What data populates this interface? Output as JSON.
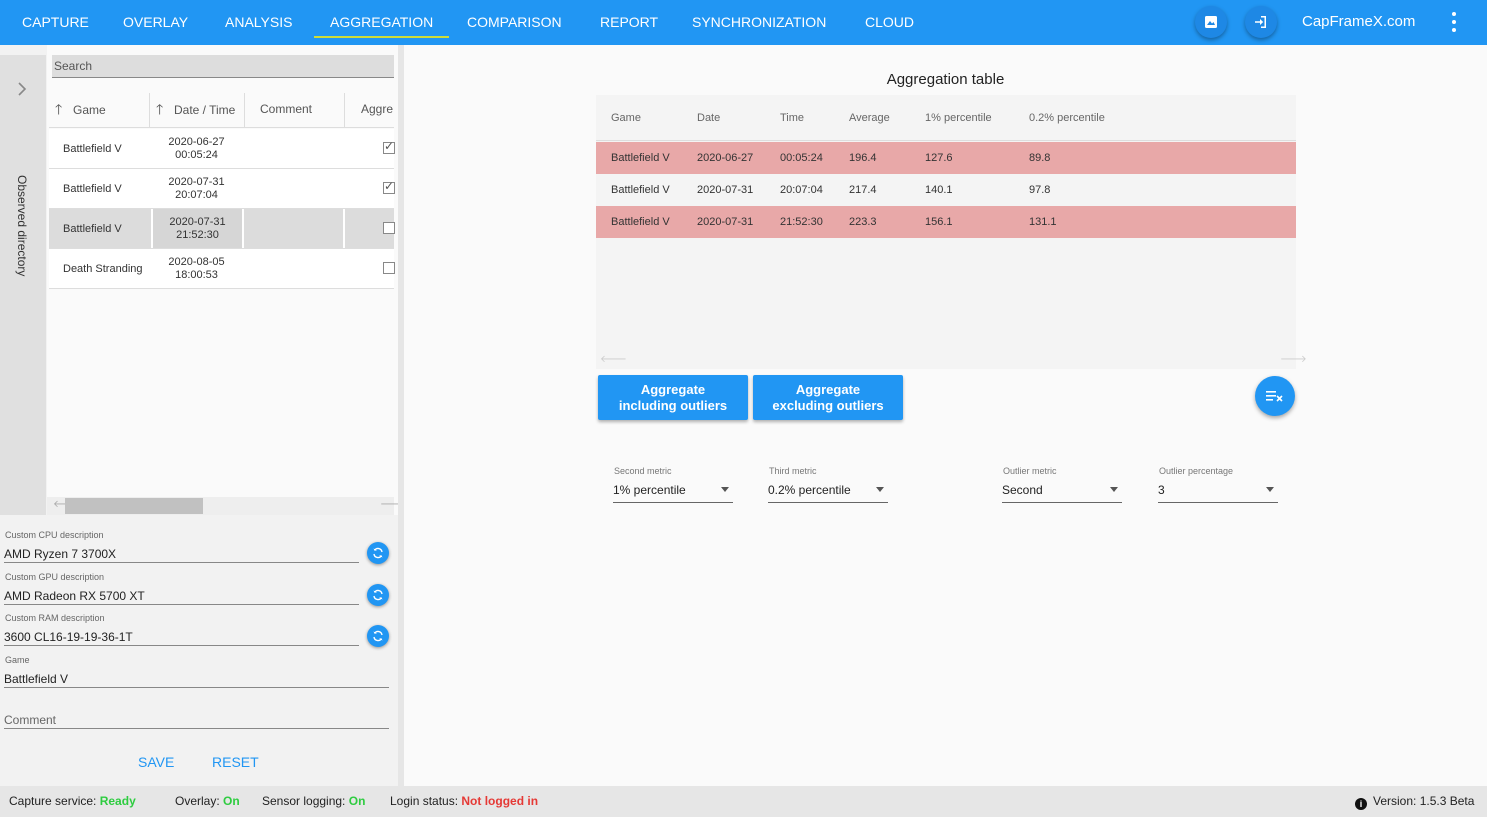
{
  "nav": {
    "tabs": [
      "CAPTURE",
      "OVERLAY",
      "ANALYSIS",
      "AGGREGATION",
      "COMPARISON",
      "REPORT",
      "SYNCHRONIZATION",
      "CLOUD"
    ],
    "active_tab": "AGGREGATION",
    "icons": [
      "screenshot-icon",
      "login-icon",
      "more-vert-icon"
    ],
    "brand": "CapFrameX.com"
  },
  "observed_directory": {
    "label": "Observed directory"
  },
  "records": {
    "search_placeholder": "Search",
    "columns": [
      "Game",
      "Date / Time",
      "Comment",
      "Aggre"
    ],
    "rows": [
      {
        "game": "Battlefield V",
        "date": "2020-06-27",
        "time": "00:05:24",
        "comment": "",
        "aggregate": true,
        "selected": false
      },
      {
        "game": "Battlefield V",
        "date": "2020-07-31",
        "time": "20:07:04",
        "comment": "",
        "aggregate": true,
        "selected": false
      },
      {
        "game": "Battlefield V",
        "date": "2020-07-31",
        "time": "21:52:30",
        "comment": "",
        "aggregate": false,
        "selected": true
      },
      {
        "game": "Death Stranding",
        "date": "2020-08-05",
        "time": "18:00:53",
        "comment": "",
        "aggregate": false,
        "selected": false
      }
    ]
  },
  "descriptions": {
    "cpu_label": "Custom CPU description",
    "cpu_value": "AMD Ryzen 7 3700X",
    "gpu_label": "Custom GPU description",
    "gpu_value": "AMD Radeon RX 5700 XT",
    "ram_label": "Custom RAM description",
    "ram_value": "3600 CL16-19-19-36-1T",
    "game_label": "Game",
    "game_value": "Battlefield V",
    "comment_placeholder": "Comment",
    "save_label": "SAVE",
    "reset_label": "RESET"
  },
  "aggregation": {
    "title": "Aggregation table",
    "columns": [
      "Game",
      "Date",
      "Time",
      "Average",
      "1% percentile",
      "0.2% percentile"
    ],
    "rows": [
      {
        "game": "Battlefield V",
        "date": "2020-06-27",
        "time": "00:05:24",
        "average": "196.4",
        "p1": "127.6",
        "p02": "89.8",
        "outlier": true
      },
      {
        "game": "Battlefield V",
        "date": "2020-07-31",
        "time": "20:07:04",
        "average": "217.4",
        "p1": "140.1",
        "p02": "97.8",
        "outlier": false
      },
      {
        "game": "Battlefield V",
        "date": "2020-07-31",
        "time": "21:52:30",
        "average": "223.3",
        "p1": "156.1",
        "p02": "131.1",
        "outlier": true
      }
    ],
    "outlier_color": "#e8a8a8",
    "btn_incl_line1": "Aggregate",
    "btn_incl_line2": "including outliers",
    "btn_excl_line1": "Aggregate",
    "btn_excl_line2": "excluding outliers",
    "clear_icon": "clear-list-icon"
  },
  "settings": {
    "second_metric_label": "Second metric",
    "second_metric_value": "1% percentile",
    "third_metric_label": "Third metric",
    "third_metric_value": "0.2% percentile",
    "outlier_metric_label": "Outlier metric",
    "outlier_metric_value": "Second",
    "outlier_percentage_label": "Outlier percentage",
    "outlier_percentage_value": "3"
  },
  "status": {
    "capture_label": "Capture service:",
    "capture_value": "Ready",
    "overlay_label": "Overlay:",
    "overlay_value": "On",
    "sensor_label": "Sensor logging:",
    "sensor_value": "On",
    "login_label": "Login status:",
    "login_value": "Not logged in",
    "version_label": "Version:",
    "version_value": "1.5.3 Beta"
  },
  "colors": {
    "accent": "#2196f3",
    "active_underline": "#cddc39",
    "ok": "#2ecc40",
    "error": "#e53935"
  }
}
